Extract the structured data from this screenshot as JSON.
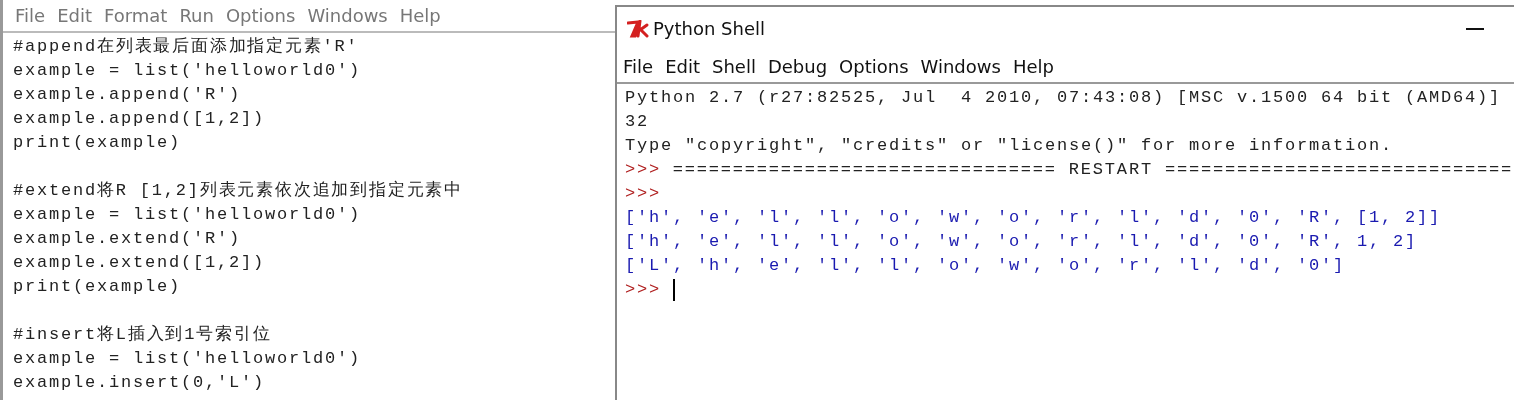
{
  "editor": {
    "menu": [
      "File",
      "Edit",
      "Format",
      "Run",
      "Options",
      "Windows",
      "Help"
    ],
    "blocks": [
      {
        "lines": [
          "#append在列表最后面添加指定元素'R'",
          "example = list('helloworld0')",
          "example.append('R')",
          "example.append([1,2])",
          "print(example)"
        ]
      },
      {
        "lines": [
          "#extend将R [1,2]列表元素依次追加到指定元素中",
          "example = list('helloworld0')",
          "example.extend('R')",
          "example.extend([1,2])",
          "print(example)"
        ]
      },
      {
        "lines": [
          "#insert将L插入到1号索引位",
          "example = list('helloworld0')",
          "example.insert(0,'L')"
        ]
      }
    ]
  },
  "shell": {
    "title": "Python Shell",
    "menu": [
      "File",
      "Edit",
      "Shell",
      "Debug",
      "Options",
      "Windows",
      "Help"
    ],
    "lines": [
      {
        "kind": "info",
        "text": "Python 2.7 (r27:82525, Jul  4 2010, 07:43:08) [MSC v.1500 64 bit (AMD64)]"
      },
      {
        "kind": "info",
        "text": "32"
      },
      {
        "kind": "info",
        "text": "Type \"copyright\", \"credits\" or \"license()\" for more information."
      },
      {
        "kind": "prompt",
        "prompt": ">>>",
        "text": "================================ RESTART ============================="
      },
      {
        "kind": "prompt",
        "prompt": ">>>"
      },
      {
        "kind": "output",
        "text": "['h', 'e', 'l', 'l', 'o', 'w', 'o', 'r', 'l', 'd', '0', 'R', [1, 2]]"
      },
      {
        "kind": "output",
        "text": "['h', 'e', 'l', 'l', 'o', 'w', 'o', 'r', 'l', 'd', '0', 'R', 1, 2]"
      },
      {
        "kind": "output",
        "text": "['L', 'h', 'e', 'l', 'l', 'o', 'w', 'o', 'r', 'l', 'd', '0']"
      },
      {
        "kind": "input",
        "prompt": ">>>"
      }
    ]
  }
}
